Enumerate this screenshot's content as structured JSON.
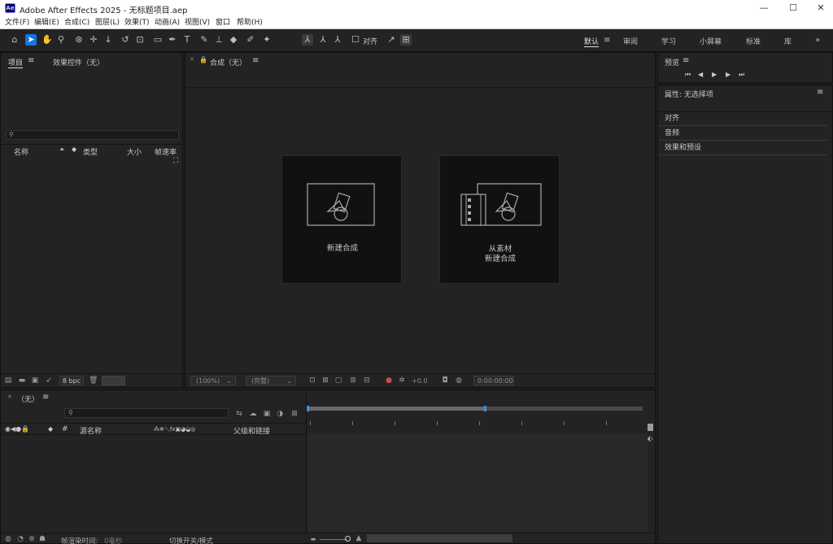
{
  "window": {
    "app_icon": "Ae",
    "title": "Adobe After Effects 2025 - 无标题项目.aep",
    "minimize": "—",
    "maximize": "☐",
    "close": "✕"
  },
  "menu": [
    "文件(F)",
    "编辑(E)",
    "合成(C)",
    "图层(L)",
    "效果(T)",
    "动画(A)",
    "视图(V)",
    "窗口",
    "帮助(H)"
  ],
  "toolbar": {
    "align_label": "对齐"
  },
  "workspaces": {
    "default": "默认",
    "review": "审阅",
    "learn": "学习",
    "small_screen": "小屏幕",
    "standard": "标准",
    "library": "库",
    "more": "»"
  },
  "project_panel": {
    "tab_project": "项目",
    "tab_effects": "效果控件（无）",
    "search_glyph": "⚲",
    "columns": {
      "name": "名称",
      "type": "类型",
      "size": "大小",
      "framerate": "帧速率"
    },
    "bpc": "8 bpc"
  },
  "comp_panel": {
    "tab": "合成（无）",
    "new_comp": "新建合成",
    "from_footage_line1": "从素材",
    "from_footage_line2": "新建合成",
    "zoom": "(100%)",
    "resolution": "(完整)",
    "exposure": "+0.0",
    "timecode": "0:00:00:00"
  },
  "preview_panel": {
    "title": "预览"
  },
  "properties_panel": {
    "title": "属性: 无选择项",
    "sections": [
      "对齐",
      "音频",
      "效果和预设"
    ]
  },
  "timeline": {
    "tab": "（无）",
    "columns": {
      "hash": "#",
      "source_name": "源名称",
      "parent": "父级和链接"
    },
    "footer_render_label": "帧渲染时间:",
    "footer_render_value": "0毫秒",
    "footer_switch": "切换开关/模式"
  },
  "colors": {
    "accent": "#1473e6",
    "bg": "#1d1d1d",
    "panel": "#232323",
    "card": "#111111"
  }
}
